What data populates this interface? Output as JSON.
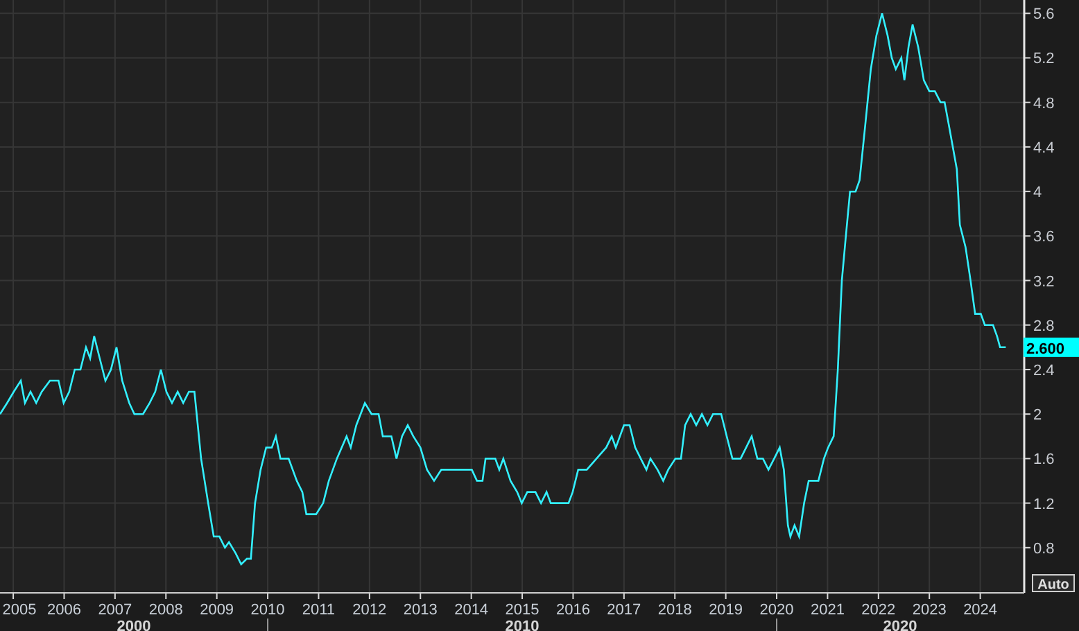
{
  "chart": {
    "chart_data": {
      "type": "line",
      "x": [
        2004.74,
        2004.88,
        2005.01,
        2005.15,
        2005.23,
        2005.34,
        2005.45,
        2005.56,
        2005.72,
        2005.89,
        2005.99,
        2006.1,
        2006.21,
        2006.32,
        2006.43,
        2006.51,
        2006.59,
        2006.7,
        2006.81,
        2006.92,
        2007.03,
        2007.14,
        2007.28,
        2007.38,
        2007.55,
        2007.68,
        2007.79,
        2007.9,
        2008.01,
        2008.12,
        2008.23,
        2008.34,
        2008.45,
        2008.56,
        2008.69,
        2008.83,
        2008.94,
        2009.05,
        2009.16,
        2009.24,
        2009.37,
        2009.48,
        2009.59,
        2009.67,
        2009.75,
        2009.86,
        2009.97,
        2010.08,
        2010.16,
        2010.25,
        2010.41,
        2010.57,
        2010.68,
        2010.76,
        2010.95,
        2011.09,
        2011.2,
        2011.36,
        2011.55,
        2011.63,
        2011.74,
        2011.91,
        2012.04,
        2012.18,
        2012.26,
        2012.43,
        2012.53,
        2012.64,
        2012.75,
        2012.86,
        2013.0,
        2013.13,
        2013.27,
        2013.41,
        2014.01,
        2014.11,
        2014.22,
        2014.28,
        2014.47,
        2014.55,
        2014.63,
        2014.77,
        2014.9,
        2014.99,
        2015.1,
        2015.26,
        2015.37,
        2015.48,
        2015.56,
        2015.91,
        2015.99,
        2016.1,
        2016.27,
        2016.46,
        2016.65,
        2016.76,
        2016.84,
        2017.0,
        2017.11,
        2017.22,
        2017.33,
        2017.44,
        2017.52,
        2017.66,
        2017.77,
        2017.87,
        2018.01,
        2018.12,
        2018.2,
        2018.31,
        2018.42,
        2018.53,
        2018.64,
        2018.75,
        2018.91,
        2019.02,
        2019.13,
        2019.29,
        2019.4,
        2019.51,
        2019.62,
        2019.73,
        2019.84,
        2019.95,
        2020.06,
        2020.14,
        2020.22,
        2020.27,
        2020.35,
        2020.44,
        2020.54,
        2020.63,
        2020.82,
        2020.93,
        2021.01,
        2021.12,
        2021.2,
        2021.28,
        2021.36,
        2021.44,
        2021.55,
        2021.63,
        2021.74,
        2021.85,
        2021.96,
        2022.07,
        2022.18,
        2022.26,
        2022.34,
        2022.45,
        2022.51,
        2022.59,
        2022.67,
        2022.78,
        2022.89,
        2023.0,
        2023.11,
        2023.22,
        2023.3,
        2023.38,
        2023.46,
        2023.54,
        2023.6,
        2023.71,
        2023.81,
        2023.9,
        2024.01,
        2024.09,
        2024.25,
        2024.33,
        2024.39,
        2024.5
      ],
      "series": [
        {
          "color": "#33f0ff",
          "values": [
            2.0,
            2.1,
            2.2,
            2.3,
            2.1,
            2.2,
            2.1,
            2.2,
            2.3,
            2.3,
            2.1,
            2.2,
            2.4,
            2.4,
            2.6,
            2.5,
            2.7,
            2.5,
            2.3,
            2.4,
            2.6,
            2.3,
            2.1,
            2.0,
            2.0,
            2.1,
            2.2,
            2.4,
            2.2,
            2.1,
            2.2,
            2.1,
            2.2,
            2.2,
            1.6,
            1.2,
            0.9,
            0.9,
            0.8,
            0.85,
            0.75,
            0.65,
            0.7,
            0.7,
            1.2,
            1.5,
            1.7,
            1.7,
            1.8,
            1.6,
            1.6,
            1.4,
            1.3,
            1.1,
            1.1,
            1.2,
            1.4,
            1.6,
            1.8,
            1.7,
            1.9,
            2.1,
            2.0,
            2.0,
            1.8,
            1.8,
            1.6,
            1.8,
            1.9,
            1.8,
            1.7,
            1.5,
            1.4,
            1.5,
            1.5,
            1.4,
            1.4,
            1.6,
            1.6,
            1.5,
            1.6,
            1.4,
            1.3,
            1.2,
            1.3,
            1.3,
            1.2,
            1.3,
            1.2,
            1.2,
            1.3,
            1.5,
            1.5,
            1.6,
            1.7,
            1.8,
            1.7,
            1.9,
            1.9,
            1.7,
            1.6,
            1.5,
            1.6,
            1.5,
            1.4,
            1.5,
            1.6,
            1.6,
            1.9,
            2.0,
            1.9,
            2.0,
            1.9,
            2.0,
            2.0,
            1.8,
            1.6,
            1.6,
            1.7,
            1.8,
            1.6,
            1.6,
            1.5,
            1.6,
            1.7,
            1.5,
            1.0,
            0.9,
            1.0,
            0.9,
            1.2,
            1.4,
            1.4,
            1.6,
            1.7,
            1.8,
            2.4,
            3.2,
            3.6,
            4.0,
            4.0,
            4.1,
            4.6,
            5.1,
            5.4,
            5.6,
            5.4,
            5.2,
            5.1,
            5.2,
            5.0,
            5.3,
            5.5,
            5.3,
            5.0,
            4.9,
            4.9,
            4.8,
            4.8,
            4.6,
            4.4,
            4.2,
            3.7,
            3.5,
            3.2,
            2.9,
            2.9,
            2.8,
            2.8,
            2.7,
            2.6,
            2.6
          ]
        }
      ],
      "xlim": [
        2004.74,
        2024.85
      ],
      "ylim": [
        0.4,
        5.72
      ],
      "xticks": [
        2005,
        2006,
        2007,
        2008,
        2009,
        2010,
        2011,
        2012,
        2013,
        2014,
        2015,
        2016,
        2017,
        2018,
        2019,
        2020,
        2021,
        2022,
        2023,
        2024
      ],
      "yticks": [
        0.8,
        1.2,
        1.6,
        2,
        2.4,
        2.8,
        3.2,
        3.6,
        {
          "value": 4,
          "label": "4"
        },
        4.4,
        4.8,
        5.2,
        5.6
      ],
      "grid": true
    },
    "axis_groups": [
      "2000",
      "2010",
      "2020"
    ],
    "last_value_label": "2.600",
    "scale_button": "Auto"
  }
}
